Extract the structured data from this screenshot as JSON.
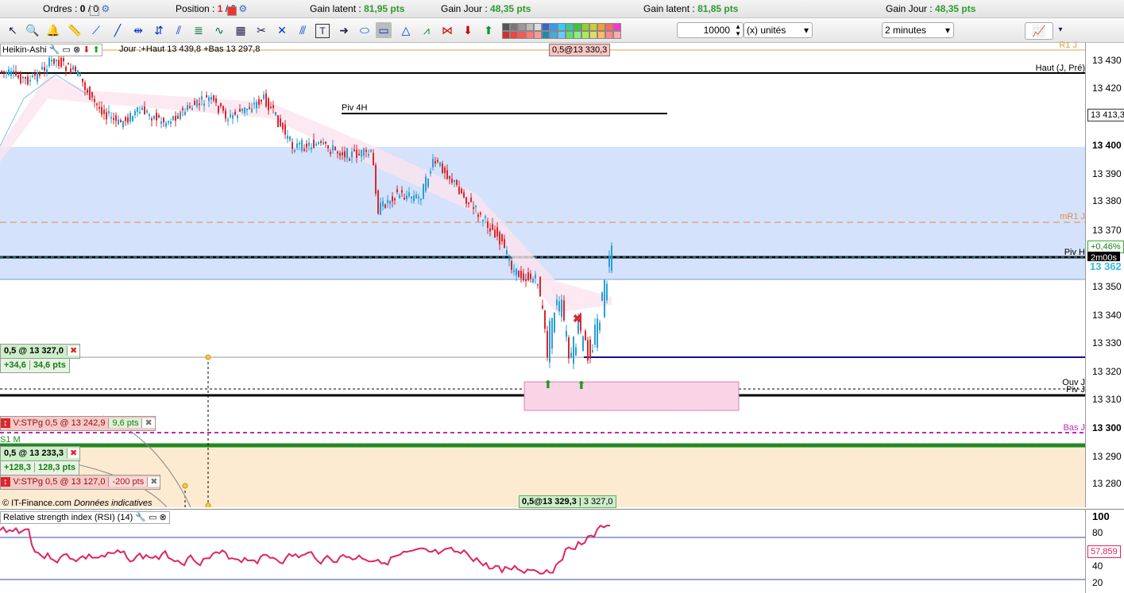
{
  "statusbar": {
    "orders_label": "Ordres :",
    "orders_value": "0",
    "orders_total": "/ 0",
    "position_label": "Position :",
    "position_value": "1",
    "position_total": "/ 0",
    "gain_latent_1_label": "Gain latent :",
    "gain_latent_1_value": "81,95 pts",
    "gain_jour_1_label": "Gain Jour :",
    "gain_jour_1_value": "48,35 pts",
    "gain_latent_2_label": "Gain latent :",
    "gain_latent_2_value": "81,85 pts",
    "gain_jour_2_label": "Gain Jour :",
    "gain_jour_2_value": "48,35 pts"
  },
  "toolbar": {
    "quantity": "10000",
    "unit_select": "(x) unités",
    "timeframe_select": "2 minutes"
  },
  "chart": {
    "title": "Heikin-Ashi",
    "day_info": "Jour :+Haut 13 439,8 +Bas 13 297,8",
    "top_order_tag": "0,5@13 330,3",
    "bottom_order_tag": "0,5@13 329,3",
    "bottom_order_tag2": "3 327,0",
    "copyright": "© IT-Finance.com",
    "disclaimer": "Données indicatives",
    "level_labels": {
      "r1": "R1 J",
      "haut": "Haut (J, Pré)",
      "piv4h": "Piv 4H",
      "mr1": "mR1 J",
      "pivh": "Piv H",
      "ouvj": "Ouv J",
      "pivj": "Piv J",
      "basj": "Bas J",
      "s1m": "S1 M"
    },
    "price_axis": [
      "13 430",
      "13 420",
      "13 410",
      "13 400",
      "13 390",
      "13 380",
      "13 370",
      "13 350",
      "13 340",
      "13 330",
      "13 320",
      "13 310",
      "13 300",
      "13 290",
      "13 280"
    ],
    "current_price_tag": "13 413,3",
    "pct_tag": "+0,46%",
    "timer_tag": "2m00s",
    "last_price_tag": "13 362",
    "orders": [
      {
        "main": "0,5 @ 13 327,0",
        "pnl1": "+34,6",
        "pnl2": "34,6 pts"
      },
      {
        "main": "V:STPg  0,5 @ 13 242,9",
        "pts": "9,6 pts"
      },
      {
        "main": "0,5 @ 13 233,3",
        "pnl1": "+128,3",
        "pnl2": "128,3 pts"
      },
      {
        "main": "V:STPg  0,5 @ 13 127,0",
        "pts": "-200 pts"
      }
    ]
  },
  "rsi": {
    "title": "Relative strength index (RSI) (14)",
    "axis": [
      "100",
      "80",
      "40",
      "20"
    ],
    "value_tag": "57,859"
  },
  "colors": {
    "bull": "#2a9fd6",
    "bear": "#d9272e",
    "zone_blue": "#d4e2fb",
    "zone_orange": "#fcebd0",
    "zone_pink": "#f9d4e6",
    "rsi_line": "#e0245e"
  }
}
